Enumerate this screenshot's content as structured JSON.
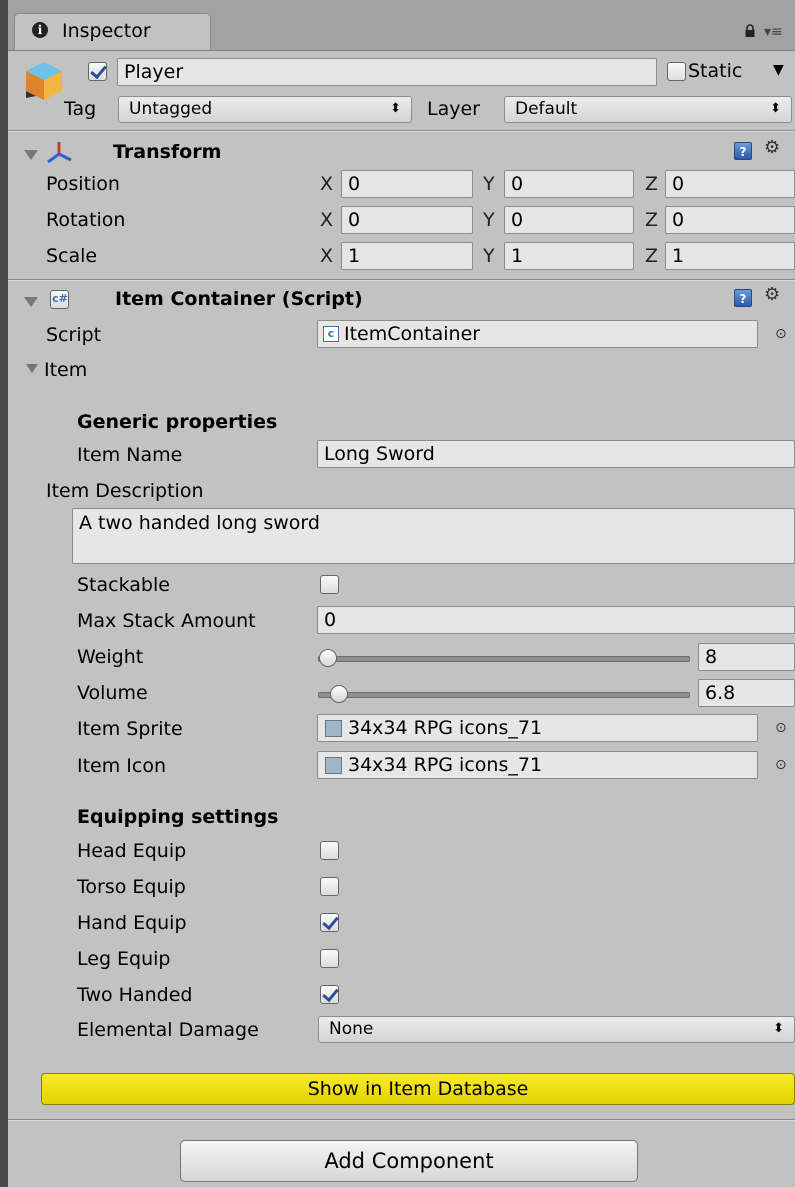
{
  "window": {
    "tab_title": "Inspector",
    "info_glyph": "i",
    "menu_glyph": "▾≡"
  },
  "gameobject": {
    "active_checked": true,
    "name": "Player",
    "static_label": "Static",
    "static_checked": false,
    "tag_label": "Tag",
    "tag_value": "Untagged",
    "layer_label": "Layer",
    "layer_value": "Default"
  },
  "transform": {
    "title": "Transform",
    "rows": [
      {
        "label": "Position",
        "x": "0",
        "y": "0",
        "z": "0"
      },
      {
        "label": "Rotation",
        "x": "0",
        "y": "0",
        "z": "0"
      },
      {
        "label": "Scale",
        "x": "1",
        "y": "1",
        "z": "1"
      }
    ],
    "axis_x": "X",
    "axis_y": "Y",
    "axis_z": "Z"
  },
  "script_component": {
    "title": "Item Container (Script)",
    "script_label": "Script",
    "script_value": "ItemContainer",
    "item_foldout": "Item",
    "generic_header": "Generic properties",
    "item_name_label": "Item Name",
    "item_name_value": "Long Sword",
    "item_desc_label": "Item Description",
    "item_desc_value": "A two handed long sword",
    "stackable_label": "Stackable",
    "stackable_checked": false,
    "max_stack_label": "Max Stack Amount",
    "max_stack_value": "0",
    "weight_label": "Weight",
    "weight_value": "8",
    "volume_label": "Volume",
    "volume_value": "6.8",
    "item_sprite_label": "Item Sprite",
    "item_sprite_value": "34x34 RPG icons_71",
    "item_icon_label": "Item Icon",
    "item_icon_value": "34x34 RPG icons_71",
    "equip_header": "Equipping settings",
    "equip": [
      {
        "label": "Head Equip",
        "checked": false
      },
      {
        "label": "Torso Equip",
        "checked": false
      },
      {
        "label": "Hand Equip",
        "checked": true
      },
      {
        "label": "Leg Equip",
        "checked": false
      },
      {
        "label": "Two Handed",
        "checked": true
      }
    ],
    "elemental_label": "Elemental Damage",
    "elemental_value": "None",
    "show_db_button": "Show in Item Database"
  },
  "add_component_button": "Add Component",
  "colors": {
    "panel_bg": "#c2c2c2",
    "highlight_button": "#f2e200",
    "transform_icon_red": "#d0392b",
    "transform_icon_blue": "#2f5fd0"
  },
  "icons": {
    "lock": "lock-icon",
    "menu": "context-menu-icon",
    "gameobject": "cube-icon",
    "help": "help-book-icon",
    "gear": "gear-icon",
    "script": "csharp-script-icon",
    "object_picker": "object-picker-icon",
    "sprite": "sprite-icon"
  }
}
